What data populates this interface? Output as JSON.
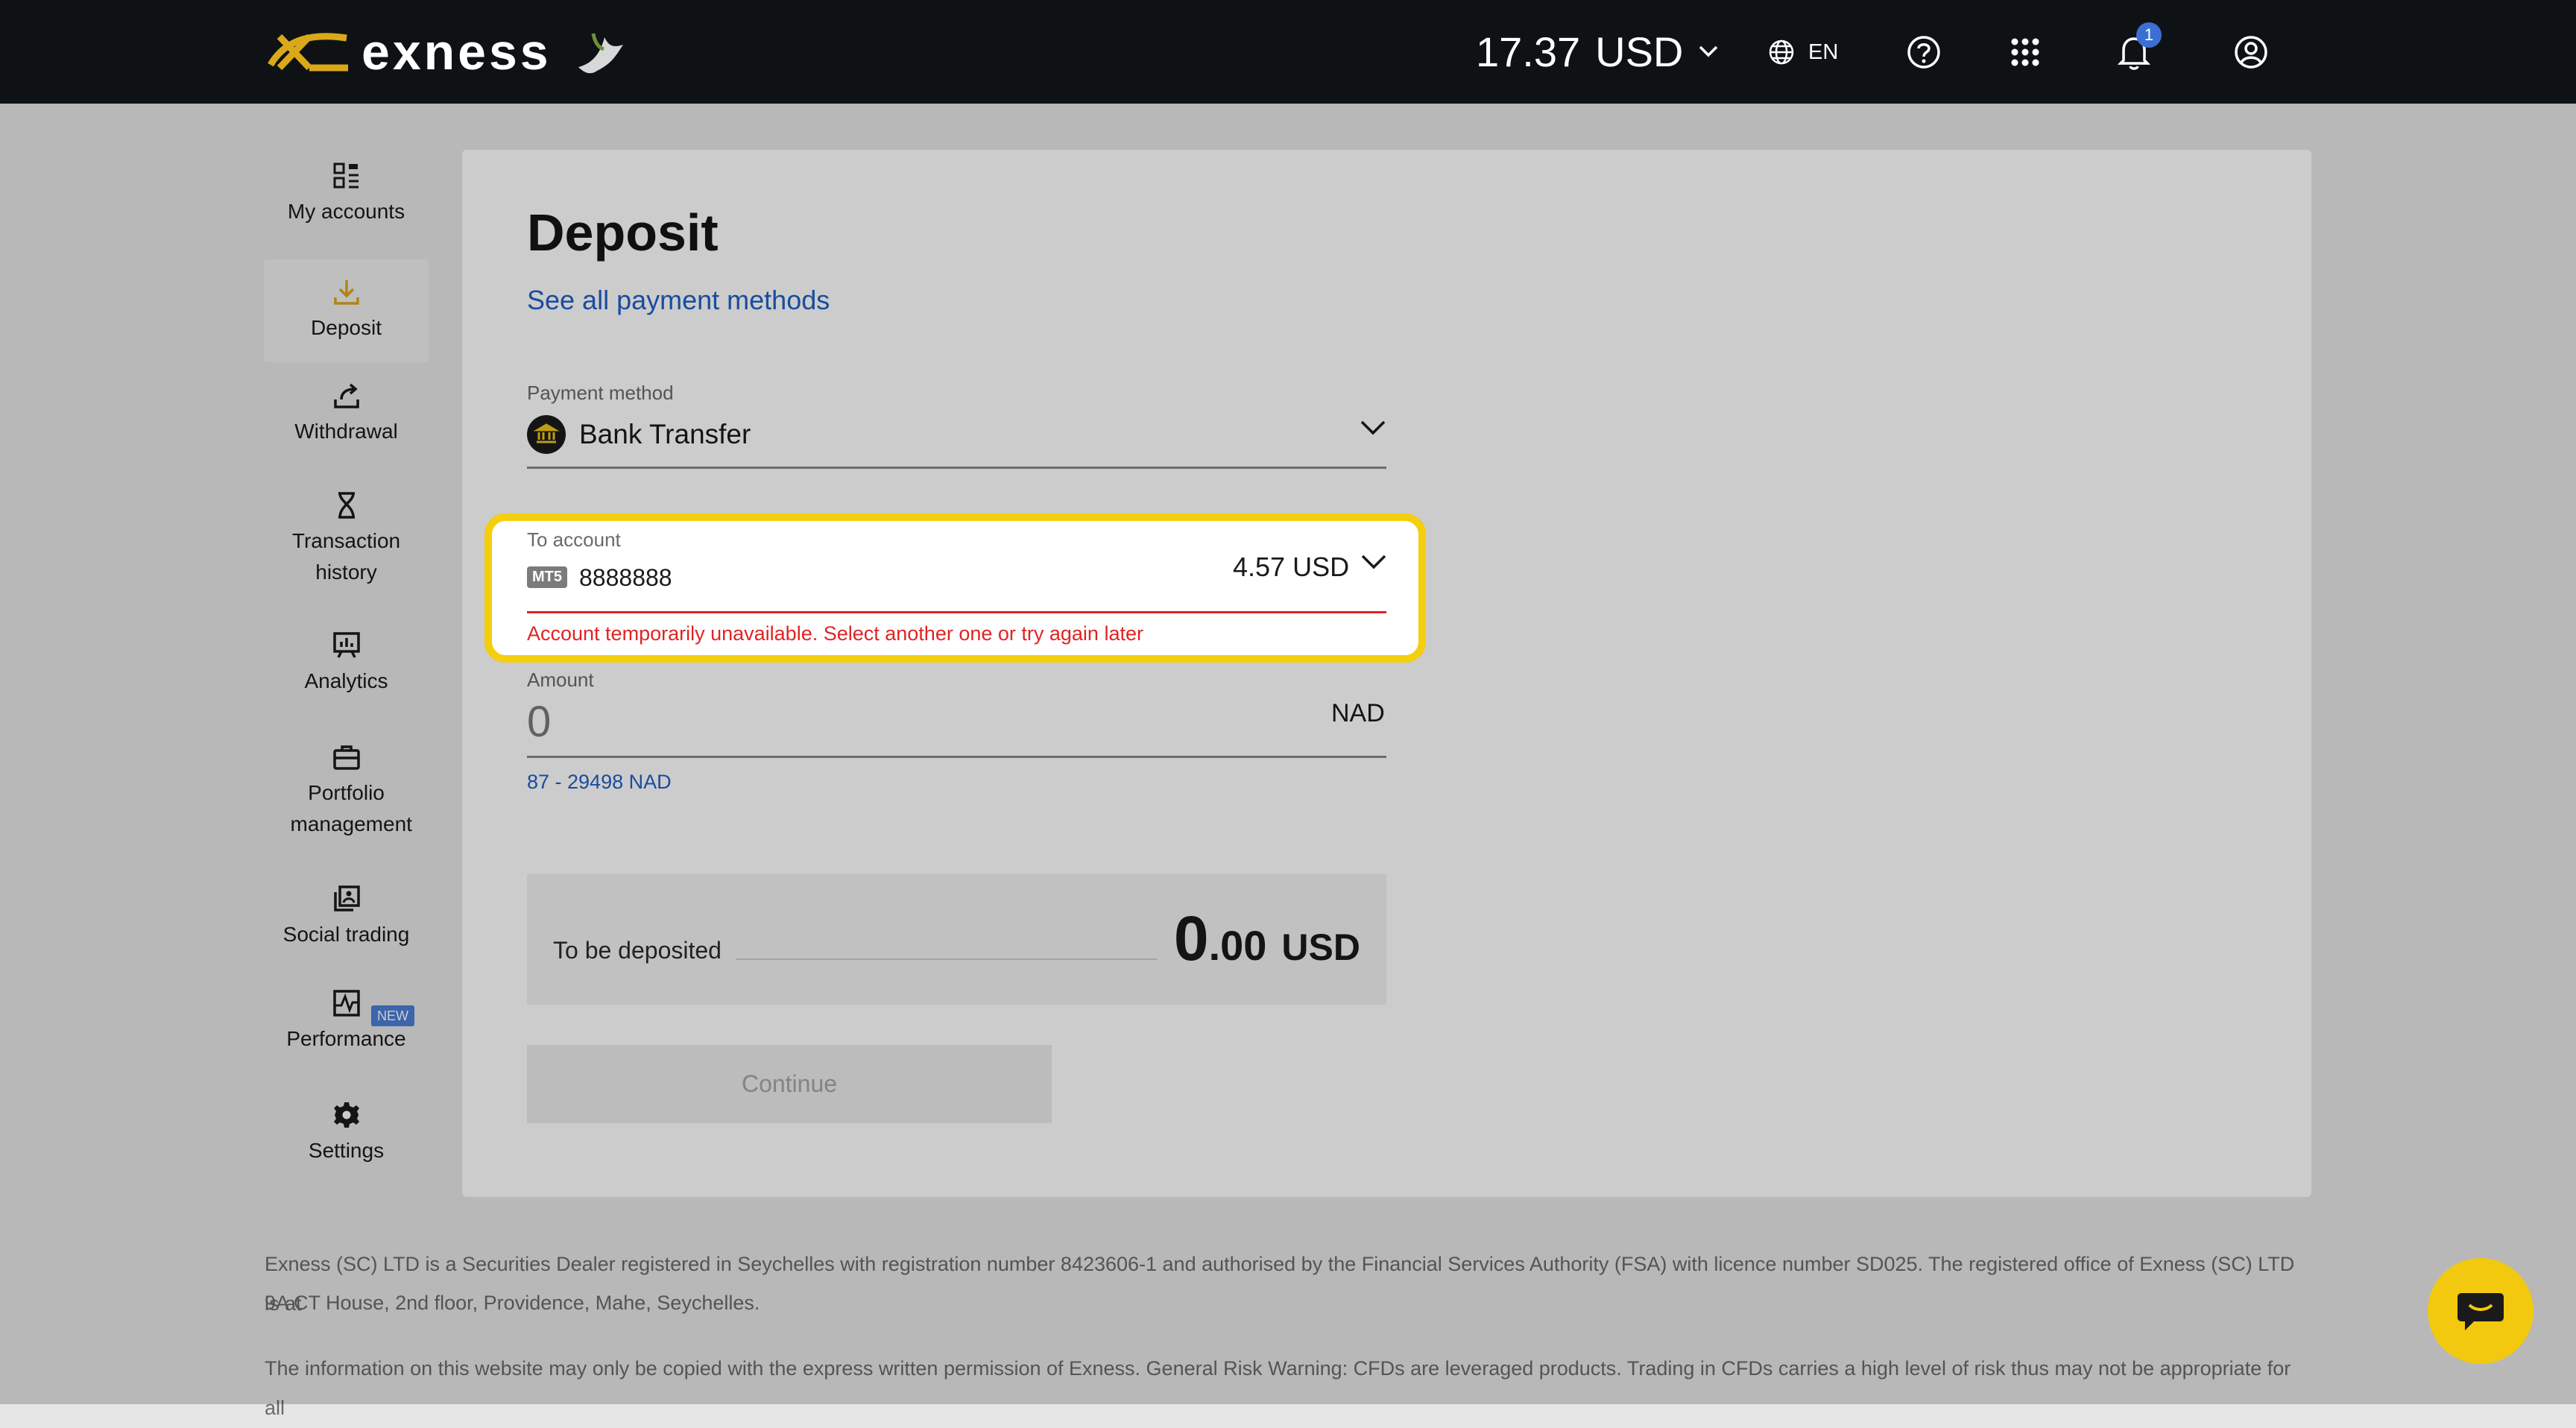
{
  "header": {
    "logo_text": "exness",
    "balance_amount": "17.37",
    "balance_currency": "USD",
    "language": "EN",
    "notification_count": "1"
  },
  "sidebar": {
    "items": [
      {
        "label": "My accounts",
        "icon": "dashboard-icon"
      },
      {
        "label": "Deposit",
        "icon": "download-icon",
        "active": true
      },
      {
        "label": "Withdrawal",
        "icon": "upload-icon"
      },
      {
        "label": "Transaction history",
        "icon": "hourglass-icon"
      },
      {
        "label": "Analytics",
        "icon": "chart-board-icon"
      },
      {
        "label": "Portfolio management",
        "icon": "briefcase-icon"
      },
      {
        "label": "Social trading",
        "icon": "social-trading-icon"
      },
      {
        "label": "Performance",
        "icon": "performance-icon",
        "badge": "NEW"
      },
      {
        "label": "Settings",
        "icon": "gear-icon"
      }
    ]
  },
  "main": {
    "title": "Deposit",
    "payment_methods_link": "See all payment methods",
    "payment_method": {
      "label": "Payment method",
      "value": "Bank Transfer"
    },
    "to_account": {
      "label": "To account",
      "platform": "MT5",
      "number": "8888888",
      "balance": "4.57 USD",
      "error": "Account temporarily unavailable. Select another one or try again later"
    },
    "amount": {
      "label": "Amount",
      "value": "0",
      "currency": "NAD",
      "range": "87 - 29498 NAD"
    },
    "to_be_deposited": {
      "label": "To be deposited",
      "integer": "0",
      "decimal": ".00",
      "currency": "USD"
    },
    "continue_label": "Continue"
  },
  "footer": {
    "line1": "Exness (SC) LTD is a Securities Dealer registered in Seychelles with registration number 8423606-1 and authorised by the Financial Services Authority (FSA) with licence number SD025. The registered office of Exness (SC) LTD is at",
    "line2": "9A CT House, 2nd floor, Providence, Mahe, Seychelles.",
    "line3": "The information on this website may only be copied with the express written permission of Exness. General Risk Warning: CFDs are leveraged products. Trading in CFDs carries a high level of risk thus may not be appropriate for all"
  },
  "colors": {
    "brand_yellow": "#f5cf0f",
    "error_red": "#e02424",
    "link_blue": "#1f5fc7",
    "header_bg": "#0f1215"
  }
}
